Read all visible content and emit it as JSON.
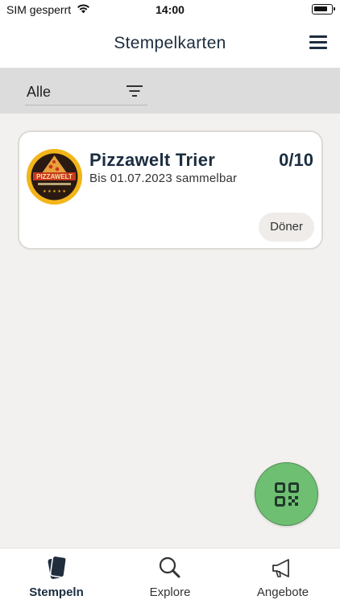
{
  "status_bar": {
    "carrier": "SIM gesperrt",
    "time": "14:00"
  },
  "header": {
    "title": "Stempelkarten",
    "menu_icon": "hamburger-menu-icon"
  },
  "filter": {
    "selected": "Alle",
    "icon": "filter-icon"
  },
  "cards": [
    {
      "shop_name": "Pizzawelt Trier",
      "stamps": "0/10",
      "valid_text": "Bis 01.07.2023 sammelbar",
      "category": "Döner",
      "logo_text": "PIZZAWELT",
      "logo_colors": {
        "ring": "#f2b51a",
        "inner": "#2a1a12",
        "accent": "#c8391f"
      }
    }
  ],
  "fab": {
    "icon": "qr-code-icon",
    "color": "#6fbf73"
  },
  "tabs": [
    {
      "label": "Stempeln",
      "icon": "stamp-cards-icon",
      "active": true
    },
    {
      "label": "Explore",
      "icon": "search-icon",
      "active": false
    },
    {
      "label": "Angebote",
      "icon": "megaphone-icon",
      "active": false
    }
  ]
}
